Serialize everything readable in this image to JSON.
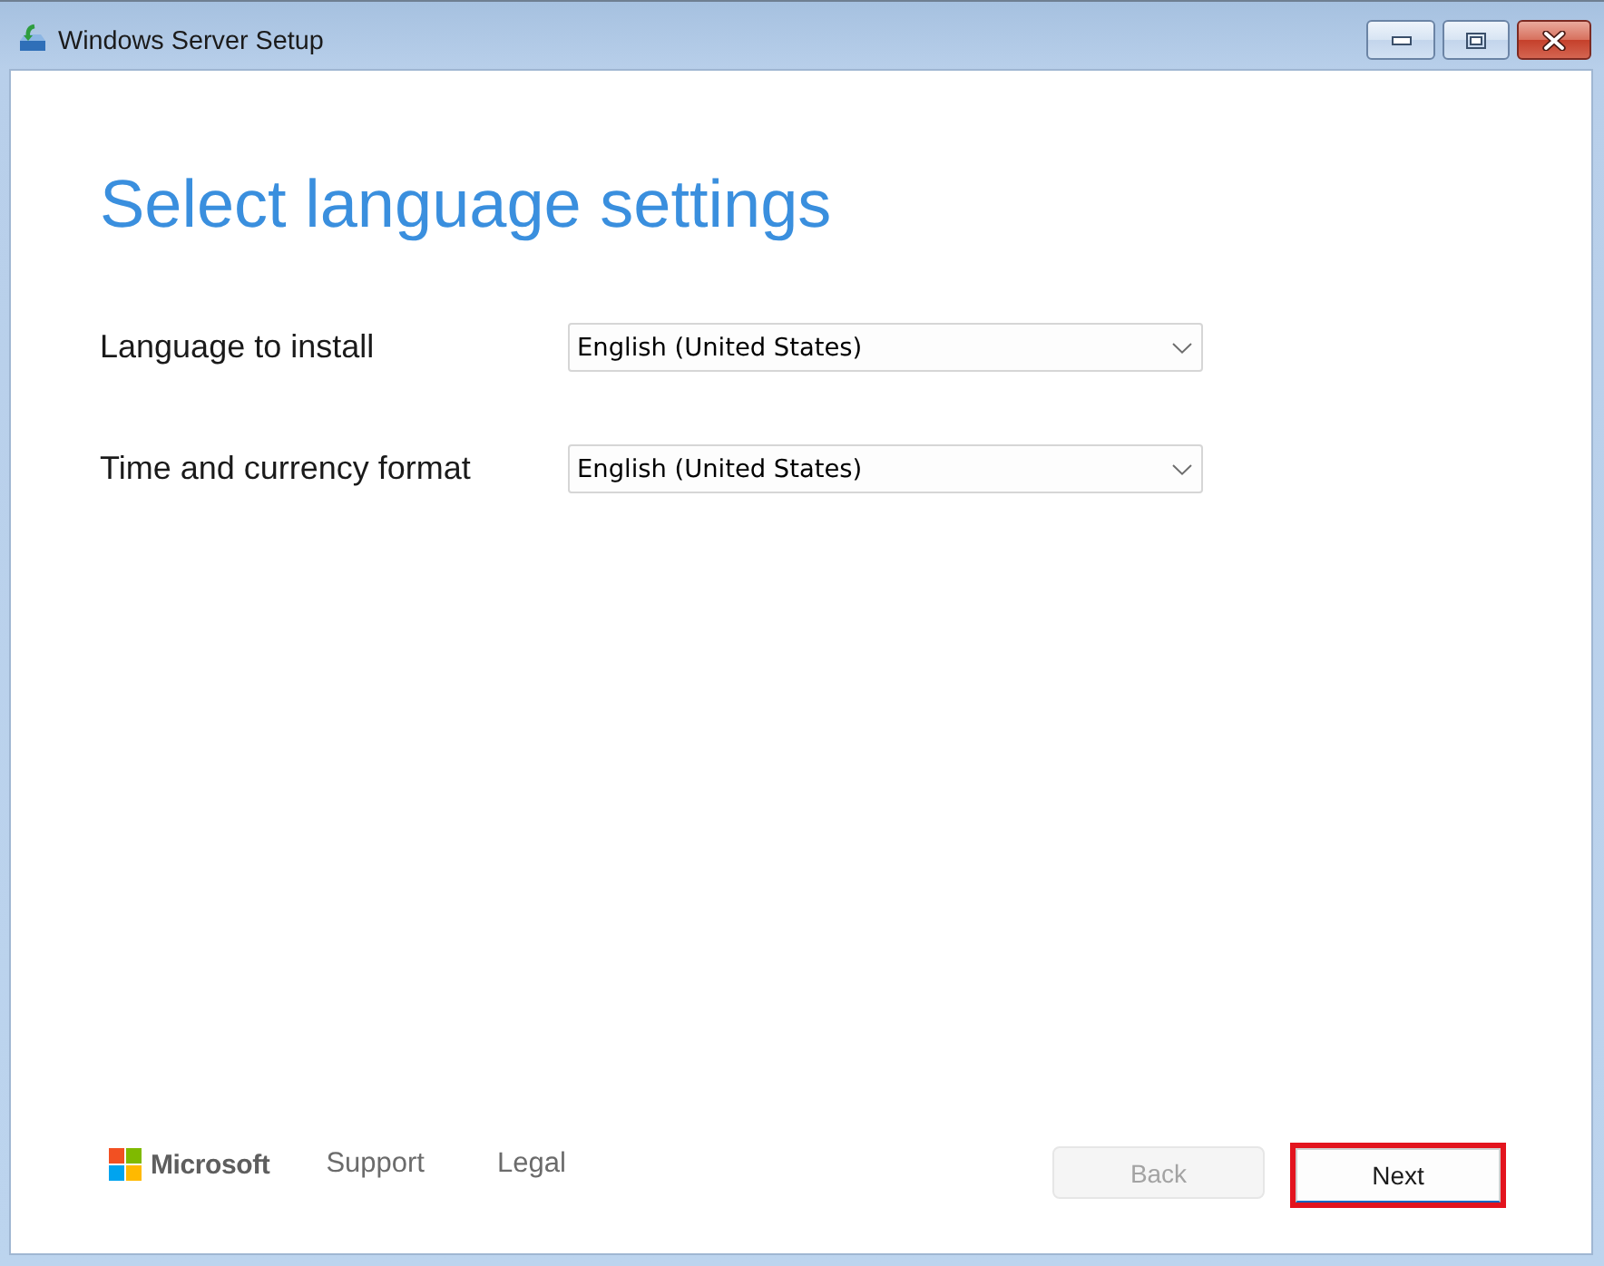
{
  "window": {
    "title": "Windows Server Setup"
  },
  "heading": "Select language settings",
  "fields": [
    {
      "label": "Language to install",
      "value": "English (United States)"
    },
    {
      "label": "Time and currency format",
      "value": "English (United States)"
    }
  ],
  "footer": {
    "brand": "Microsoft",
    "links": [
      "Support",
      "Legal"
    ],
    "buttons": [
      {
        "label": "Back",
        "disabled": true,
        "highlighted": false
      },
      {
        "label": "Next",
        "disabled": false,
        "highlighted": true
      }
    ]
  }
}
